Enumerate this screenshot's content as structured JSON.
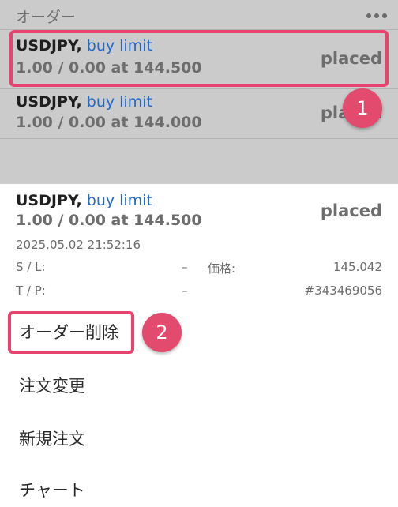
{
  "header": {
    "title": "オーダー",
    "menu_icon": "more-dots-icon"
  },
  "orders": [
    {
      "symbol": "USDJPY,",
      "type": "buy limit",
      "volume_price": "1.00 / 0.00 at 144.500",
      "status": "placed"
    },
    {
      "symbol": "USDJPY,",
      "type": "buy limit",
      "volume_price": "1.00 / 0.00 at 144.000",
      "status": "placed"
    }
  ],
  "detail": {
    "symbol": "USDJPY,",
    "type": "buy limit",
    "volume_price": "1.00 / 0.00 at 144.500",
    "status": "placed",
    "time": "2025.05.02 21:52:16",
    "sl_label": "S / L:",
    "sl_value": "–",
    "price_label": "価格:",
    "price_value": "145.042",
    "tp_label": "T / P:",
    "tp_value": "–",
    "ticket": "#343469056"
  },
  "menu": {
    "delete_order": "オーダー削除",
    "modify_order": "注文変更",
    "new_order": "新規注文",
    "chart": "チャート"
  },
  "annotations": {
    "badge_1": "1",
    "badge_2": "2",
    "highlight_color": "#e8436e",
    "badge_color": "#e24a6e"
  },
  "colors": {
    "accent_blue": "#2468c8",
    "dim_background": "#cbcbcb",
    "sheet_background": "#ffffff"
  }
}
